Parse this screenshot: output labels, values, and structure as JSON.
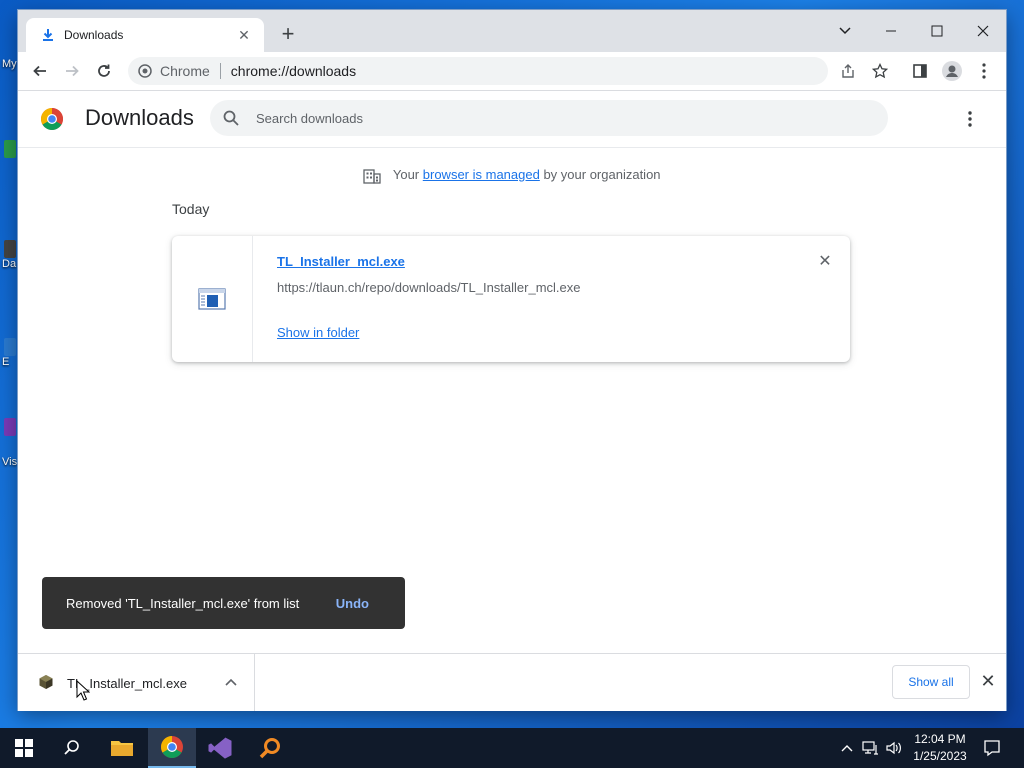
{
  "desktop": {
    "labels": [
      "My",
      "Da",
      "E",
      "Vis"
    ]
  },
  "browser": {
    "tab": {
      "title": "Downloads"
    },
    "omnibox": {
      "site_name": "Chrome",
      "url": "chrome://downloads"
    }
  },
  "downloads_page": {
    "title": "Downloads",
    "search": {
      "placeholder": "Search downloads"
    },
    "managed_notice": {
      "prefix": "Your",
      "link": "browser is managed",
      "suffix": "by your organization"
    },
    "date_heading": "Today",
    "items": [
      {
        "file_name": "TL_Installer_mcl.exe",
        "url": "https://tlaun.ch/repo/downloads/TL_Installer_mcl.exe",
        "action": "Show in folder"
      }
    ],
    "toast": {
      "message": "Removed 'TL_Installer_mcl.exe' from list",
      "undo": "Undo"
    }
  },
  "download_shelf": {
    "item": {
      "file_name": "TL_Installer_mcl.exe"
    },
    "show_all": "Show all"
  },
  "taskbar": {
    "apps": [
      "start-icon",
      "search-icon",
      "file-explorer-icon",
      "chrome-icon",
      "visual-studio-icon",
      "magnifier-app-icon"
    ],
    "clock": {
      "time": "12:04 PM",
      "date": "1/25/2023"
    }
  },
  "colors": {
    "accent": "#1a73e8",
    "toast_bg": "#323232",
    "undo_text": "#8ab4f8",
    "taskbar_bg": "#101a2a"
  }
}
